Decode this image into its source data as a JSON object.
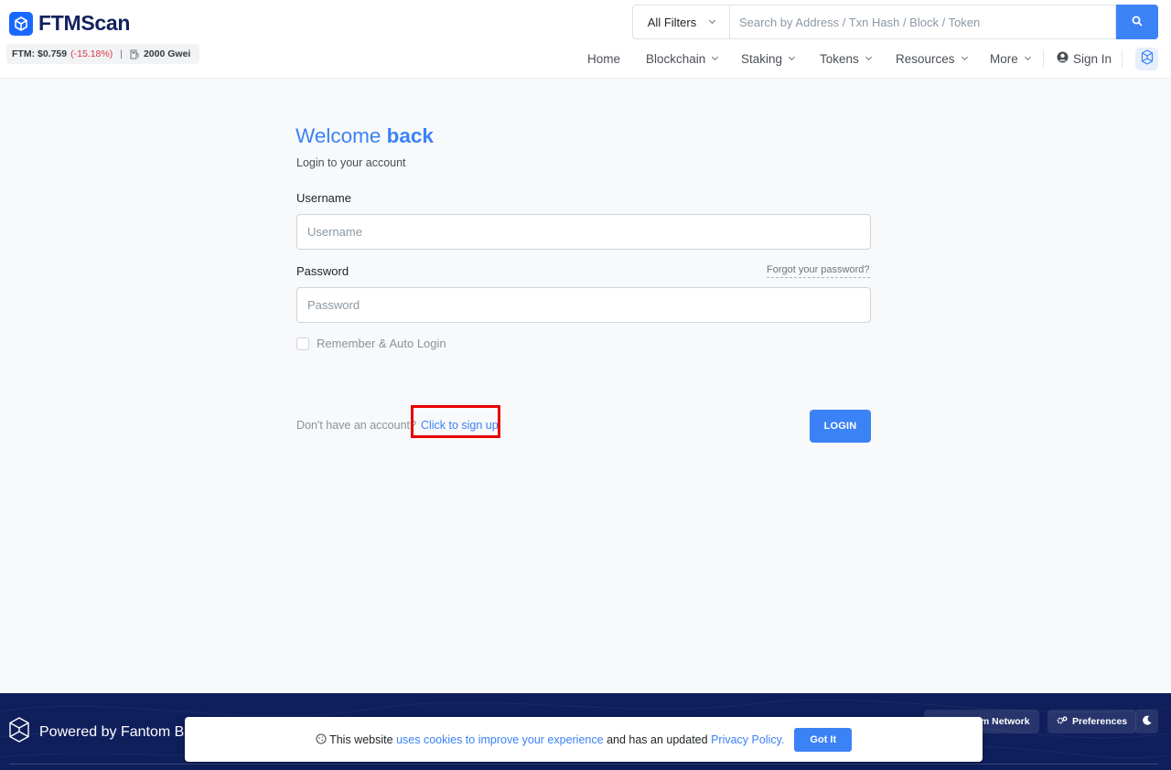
{
  "header": {
    "brand": "FTMScan",
    "price_label": "FTM: $0.759",
    "price_change": "(-15.18%)",
    "gas": "2000 Gwei",
    "search": {
      "filter_label": "All Filters",
      "placeholder": "Search by Address / Txn Hash / Block / Token"
    },
    "nav": {
      "home": "Home",
      "blockchain": "Blockchain",
      "staking": "Staking",
      "tokens": "Tokens",
      "resources": "Resources",
      "more": "More",
      "sign_in": "Sign In"
    }
  },
  "login": {
    "title_light": "Welcome ",
    "title_bold": "back",
    "subtitle": "Login to your account",
    "username_label": "Username",
    "username_placeholder": "Username",
    "password_label": "Password",
    "password_placeholder": "Password",
    "forgot_link": "Forgot your password?",
    "remember_label": "Remember & Auto Login",
    "no_account_text": "Don't have an account?",
    "signup_link": "Click to sign up",
    "login_button": "LOGIN"
  },
  "footer": {
    "powered_by": "Powered by Fantom BlockChain",
    "network_button": "Add Fantom Network",
    "preferences_button": "Preferences"
  },
  "cookie_banner": {
    "text_1": "This website",
    "link_1": "uses cookies to improve your experience",
    "text_2": "and has an updated",
    "link_2": "Privacy Policy.",
    "button": "Got It"
  },
  "colors": {
    "primary": "#3b82f6",
    "brand_navy": "#13225e",
    "footer_bg": "#0f1f5c",
    "negative": "#dc3545",
    "annotation_red": "#e60000"
  }
}
